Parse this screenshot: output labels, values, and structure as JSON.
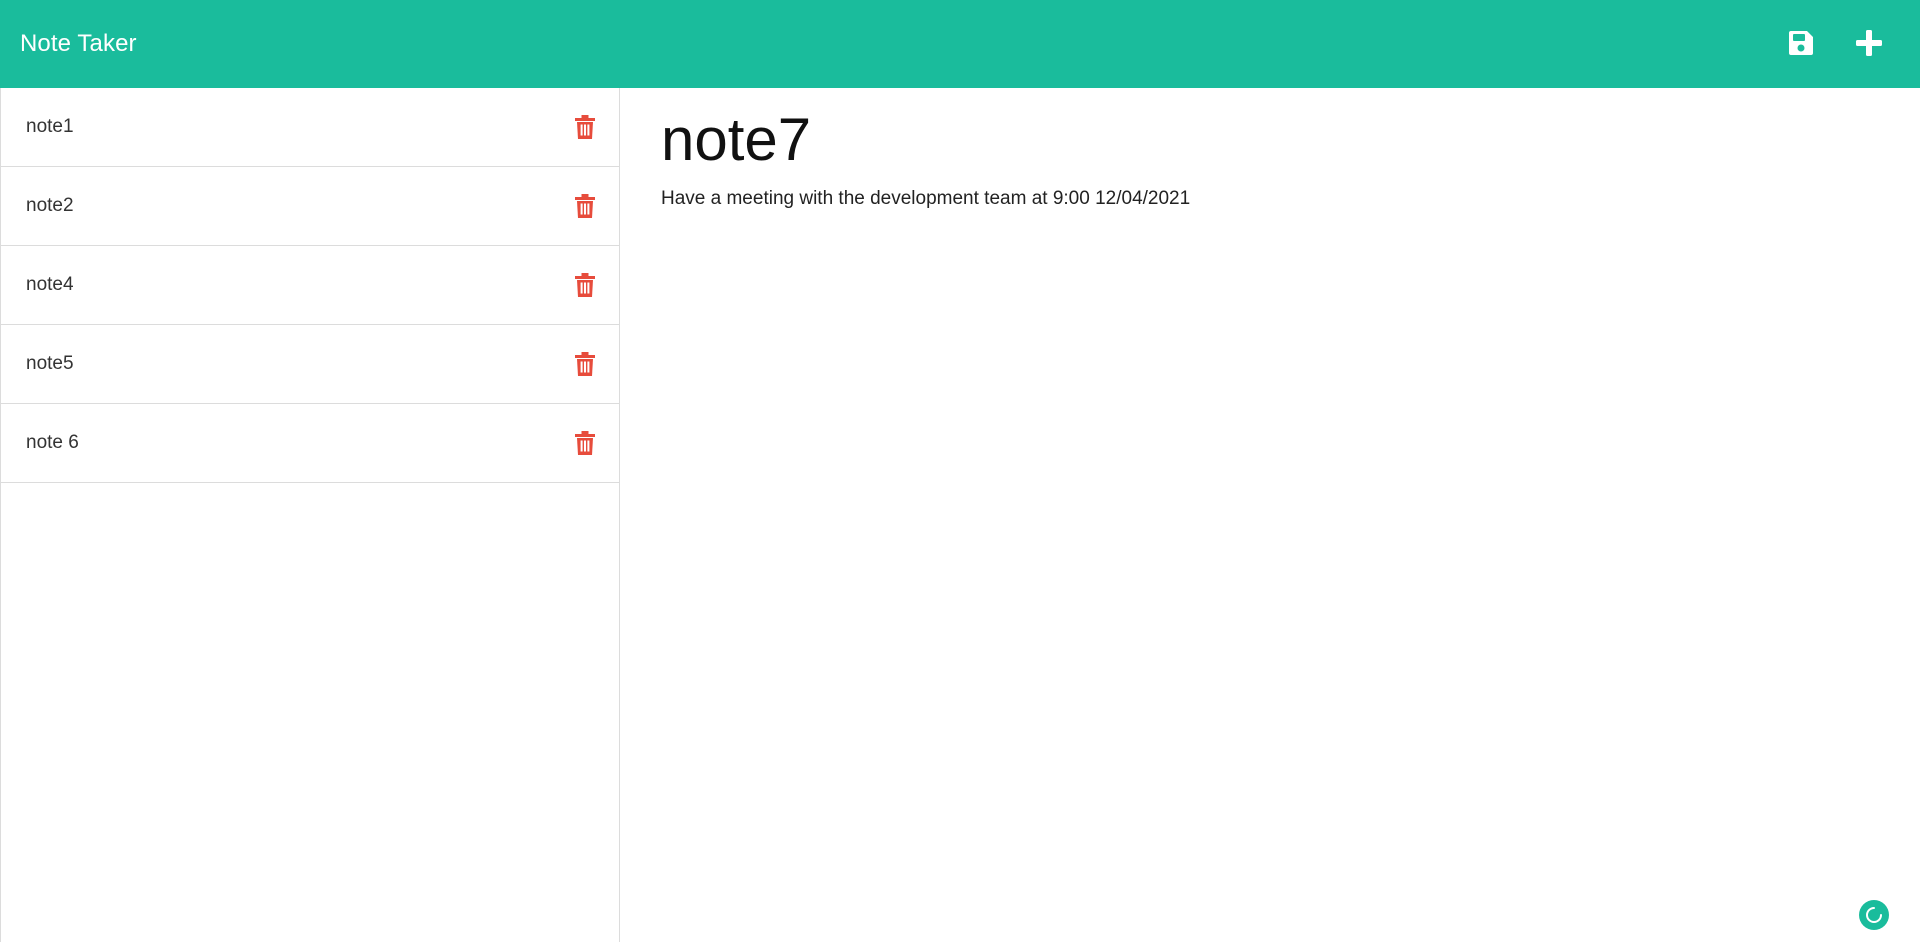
{
  "navbar": {
    "brand": "Note Taker",
    "save_icon": "save-icon",
    "new_icon": "plus-icon",
    "bg_color": "#1abc9c"
  },
  "sidebar": {
    "notes": [
      {
        "title": "note1",
        "delete_icon": "trash-icon"
      },
      {
        "title": "note2",
        "delete_icon": "trash-icon"
      },
      {
        "title": "note4",
        "delete_icon": "trash-icon"
      },
      {
        "title": "note5",
        "delete_icon": "trash-icon"
      },
      {
        "title": "note 6",
        "delete_icon": "trash-icon"
      }
    ],
    "delete_color": "#e74c3c"
  },
  "main": {
    "note_title": "note7",
    "note_text": "Have a meeting with the development team at 9:00 12/04/2021"
  },
  "widget": {
    "icon": "loading-spinner-icon"
  }
}
